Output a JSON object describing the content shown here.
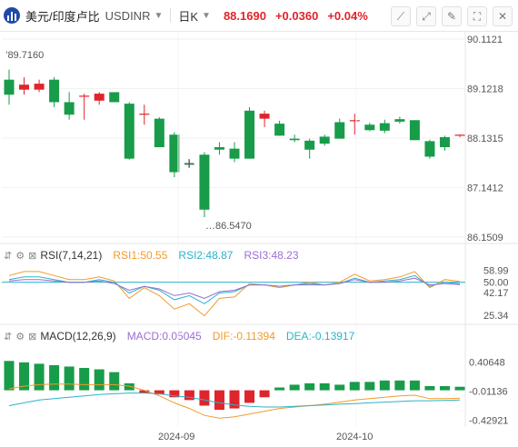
{
  "header": {
    "symbol": "美元/印度卢比",
    "code": "USDINR",
    "period": "日K",
    "price": "88.1690",
    "change": "+0.0360",
    "change_pct": "+0.04%",
    "tools": [
      "draw-line-icon",
      "trend-line-icon",
      "pencil-icon",
      "fullscreen-icon",
      "close-icon"
    ]
  },
  "colors": {
    "up": "#e0242b",
    "down": "#189c4a",
    "rsi1": "#f39a2a",
    "rsi2": "#2bb3c9",
    "rsi3": "#9a6fd0",
    "dif": "#f39a2a",
    "dea": "#2bb3c9"
  },
  "chart_data": [
    {
      "type": "candlestick",
      "y_ticks": [
        "90.1121",
        "89.1218",
        "88.1315",
        "87.1412",
        "86.1509"
      ],
      "ylim": [
        86.1509,
        90.1121
      ],
      "x_ticks": [
        "2024-09",
        "2024-10"
      ],
      "annotations": {
        "high_label": "89.7160",
        "low_label": "86.5470"
      },
      "candles": [
        [
          89.3,
          89.5,
          88.8,
          89.0
        ],
        [
          89.1,
          89.35,
          89.0,
          89.2
        ],
        [
          89.1,
          89.3,
          89.05,
          89.22
        ],
        [
          89.3,
          89.35,
          88.75,
          88.85
        ],
        [
          88.85,
          89.05,
          88.5,
          88.6
        ],
        [
          88.98,
          89.02,
          88.5,
          88.98
        ],
        [
          88.88,
          89.05,
          88.8,
          89.02
        ],
        [
          89.05,
          89.05,
          88.85,
          88.85
        ],
        [
          88.82,
          88.85,
          87.7,
          87.72
        ],
        [
          88.62,
          88.8,
          88.4,
          88.62
        ],
        [
          88.52,
          88.55,
          87.95,
          87.95
        ],
        [
          88.2,
          88.25,
          87.35,
          87.45
        ],
        [
          87.62,
          87.7,
          87.55,
          87.6
        ],
        [
          87.8,
          87.85,
          86.55,
          86.7
        ],
        [
          87.95,
          88.05,
          87.8,
          87.9
        ],
        [
          87.92,
          88.05,
          87.65,
          87.72
        ],
        [
          88.68,
          88.75,
          87.72,
          87.72
        ],
        [
          88.52,
          88.68,
          88.35,
          88.62
        ],
        [
          88.42,
          88.48,
          88.18,
          88.18
        ],
        [
          88.12,
          88.2,
          88.05,
          88.09
        ],
        [
          88.08,
          88.12,
          87.72,
          87.9
        ],
        [
          88.16,
          88.2,
          87.98,
          88.02
        ],
        [
          88.45,
          88.52,
          88.12,
          88.12
        ],
        [
          88.49,
          88.62,
          88.2,
          88.49
        ],
        [
          88.4,
          88.44,
          88.27,
          88.29
        ],
        [
          88.43,
          88.5,
          88.23,
          88.28
        ],
        [
          88.51,
          88.56,
          88.42,
          88.46
        ],
        [
          88.49,
          88.49,
          88.12,
          88.09
        ],
        [
          88.07,
          88.1,
          87.72,
          87.76
        ],
        [
          88.15,
          88.18,
          87.88,
          87.95
        ],
        [
          88.18,
          88.2,
          88.15,
          88.2
        ]
      ]
    },
    {
      "type": "line",
      "title": "RSI(7,14,21)",
      "legend": [
        {
          "label": "RSI1:50.55",
          "color": "#f39a2a"
        },
        {
          "label": "RSI2:48.87",
          "color": "#2bb3c9"
        },
        {
          "label": "RSI3:48.23",
          "color": "#9a6fd0"
        }
      ],
      "y_ticks": [
        "58.99",
        "50.00",
        "42.17",
        "25.34"
      ],
      "ylim": [
        22,
        64
      ],
      "reference_line": 50,
      "series": [
        {
          "name": "RSI1",
          "values": [
            55,
            58,
            58,
            55,
            52,
            52,
            54,
            51,
            38,
            46,
            40,
            30,
            34,
            25,
            38,
            39,
            49,
            48,
            46,
            48,
            50,
            48,
            50,
            56,
            51,
            52,
            54,
            58,
            46,
            52,
            50.55
          ]
        },
        {
          "name": "RSI2",
          "values": [
            52,
            54,
            54,
            52,
            50,
            50,
            52,
            50,
            42,
            47,
            44,
            37,
            40,
            34,
            42,
            43,
            48,
            48,
            47,
            48,
            49,
            48,
            49,
            53,
            50,
            51,
            52,
            55,
            47,
            50,
            48.87
          ]
        },
        {
          "name": "RSI3",
          "values": [
            51,
            52,
            52,
            51,
            50,
            50,
            51,
            49,
            44,
            47,
            45,
            40,
            42,
            38,
            43,
            44,
            48,
            48,
            47,
            48,
            48,
            48,
            49,
            52,
            50,
            50,
            51,
            53,
            48,
            49,
            48.23
          ]
        }
      ]
    },
    {
      "type": "bar+line",
      "title": "MACD(12,26,9)",
      "legend": [
        {
          "label": "MACD:0.05045",
          "color": "#9a6fd0"
        },
        {
          "label": "DIF:-0.11394",
          "color": "#f39a2a"
        },
        {
          "label": "DEA:-0.13917",
          "color": "#2bb3c9"
        }
      ],
      "y_ticks": [
        "0.40648",
        "-0.01136",
        "-0.42921"
      ],
      "ylim": [
        -0.5,
        0.58
      ],
      "series": [
        {
          "name": "MACD",
          "values": [
            0.42,
            0.4,
            0.38,
            0.36,
            0.34,
            0.32,
            0.3,
            0.26,
            0.1,
            -0.04,
            -0.06,
            -0.1,
            -0.14,
            -0.22,
            -0.28,
            -0.26,
            -0.18,
            -0.1,
            0.04,
            0.08,
            0.1,
            0.1,
            0.08,
            0.12,
            0.12,
            0.14,
            0.14,
            0.14,
            0.06,
            0.06,
            0.05045
          ]
        },
        {
          "name": "DIF",
          "values": [
            0.02,
            0.06,
            0.08,
            0.09,
            0.09,
            0.08,
            0.08,
            0.08,
            0.06,
            0.0,
            -0.08,
            -0.18,
            -0.26,
            -0.36,
            -0.4,
            -0.38,
            -0.34,
            -0.3,
            -0.26,
            -0.24,
            -0.22,
            -0.2,
            -0.17,
            -0.14,
            -0.12,
            -0.1,
            -0.08,
            -0.07,
            -0.12,
            -0.12,
            -0.11394
          ]
        },
        {
          "name": "DEA",
          "values": [
            -0.22,
            -0.18,
            -0.14,
            -0.12,
            -0.1,
            -0.08,
            -0.06,
            -0.05,
            -0.04,
            -0.04,
            -0.05,
            -0.08,
            -0.1,
            -0.14,
            -0.18,
            -0.21,
            -0.23,
            -0.24,
            -0.24,
            -0.23,
            -0.22,
            -0.21,
            -0.2,
            -0.19,
            -0.18,
            -0.17,
            -0.16,
            -0.15,
            -0.15,
            -0.145,
            -0.13917
          ]
        }
      ]
    }
  ]
}
